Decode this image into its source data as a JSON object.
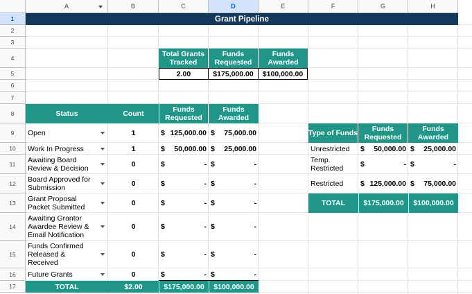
{
  "columns": [
    "A",
    "B",
    "C",
    "D",
    "E",
    "F",
    "G",
    "H"
  ],
  "rows": [
    "1",
    "2",
    "3",
    "4",
    "5",
    "6",
    "7",
    "8",
    "9",
    "10",
    "11",
    "12",
    "13",
    "14",
    "15",
    "16",
    "17"
  ],
  "title": "Grant Pipeline",
  "summary": {
    "headers": [
      "Total Grants Tracked",
      "Funds Requested",
      "Funds Awarded"
    ],
    "values": [
      "2.00",
      "$175,000.00",
      "$100,000.00"
    ]
  },
  "status_table": {
    "headers": [
      "Status",
      "Count",
      "Funds Requested",
      "Funds Awarded"
    ],
    "rows": [
      {
        "status": "Open",
        "count": "1",
        "req_sym": "$",
        "req": "125,000.00",
        "awd_sym": "$",
        "awd": "75,000.00"
      },
      {
        "status": "Work In Progress",
        "count": "1",
        "req_sym": "$",
        "req": "50,000.00",
        "awd_sym": "$",
        "awd": "25,000.00"
      },
      {
        "status": "Awaiting Board Review & Decision",
        "count": "0",
        "req_sym": "$",
        "req": "-",
        "awd_sym": "$",
        "awd": "-"
      },
      {
        "status": "Board Approved for Submission",
        "count": "0",
        "req_sym": "$",
        "req": "-",
        "awd_sym": "$",
        "awd": "-"
      },
      {
        "status": "Grant Proposal Packet Submitted",
        "count": "0",
        "req_sym": "$",
        "req": "-",
        "awd_sym": "$",
        "awd": "-"
      },
      {
        "status": "Awaiting Grantor Awardee Review & Email Notification",
        "count": "0",
        "req_sym": "$",
        "req": "-",
        "awd_sym": "$",
        "awd": "-"
      },
      {
        "status": "Funds Confirmed Released & Received",
        "count": "0",
        "req_sym": "$",
        "req": "-",
        "awd_sym": "$",
        "awd": "-"
      },
      {
        "status": "Future Grants",
        "count": "0",
        "req_sym": "$",
        "req": "-",
        "awd_sym": "$",
        "awd": "-"
      }
    ],
    "total": {
      "label": "TOTAL",
      "count": "$2.00",
      "req": "$175,000.00",
      "awd": "$100,000.00"
    }
  },
  "type_table": {
    "headers": [
      "Type of Funds",
      "Funds Requested",
      "Funds Awarded"
    ],
    "rows": [
      {
        "type": "Unrestricted",
        "req_sym": "$",
        "req": "50,000.00",
        "awd_sym": "$",
        "awd": "25,000.00"
      },
      {
        "type": "Temp. Restricted",
        "req_sym": "$",
        "req": "-",
        "awd_sym": "$",
        "awd": "-"
      },
      {
        "type": "Restricted",
        "req_sym": "$",
        "req": "125,000.00",
        "awd_sym": "$",
        "awd": "75,000.00"
      }
    ],
    "total": {
      "label": "TOTAL",
      "req": "$175,000.00",
      "awd": "$100,000.00"
    }
  },
  "colors": {
    "title_bg": "#12395b",
    "accent": "#1f9687",
    "header_selected": "#d3e3fd"
  }
}
